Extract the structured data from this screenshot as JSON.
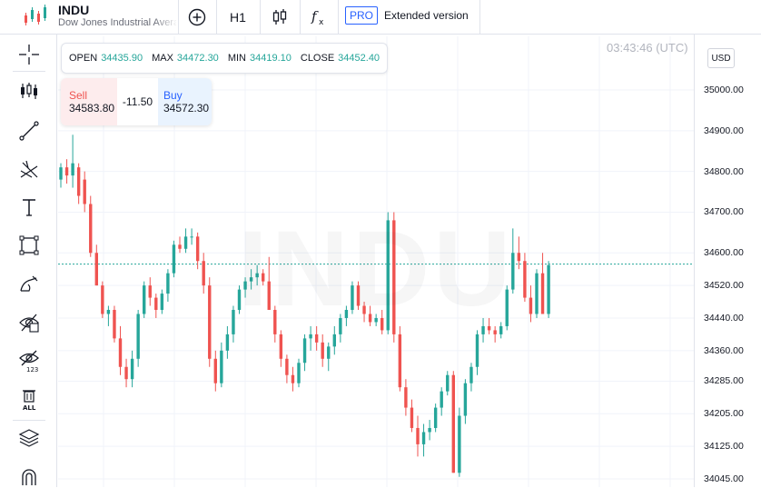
{
  "header": {
    "symbol": "INDU",
    "name": "Dow Jones Industrial Average",
    "timeframe": "H1",
    "pro_label": "PRO",
    "extended_label": "Extended version"
  },
  "ohlc": {
    "open_label": "OPEN",
    "open": "34435.90",
    "max_label": "MAX",
    "max": "34472.30",
    "min_label": "MIN",
    "min": "34419.10",
    "close_label": "CLOSE",
    "close": "34452.40"
  },
  "trade": {
    "sell_label": "Sell",
    "sell_price": "34583.80",
    "spread": "-11.50",
    "buy_label": "Buy",
    "buy_price": "34572.30"
  },
  "time": "03:43:46 (UTC)",
  "currency": "USD",
  "watermark": "INDU",
  "colors": {
    "up": "#26a69a",
    "down": "#ef5350",
    "accent": "#2962ff",
    "grid": "#f0f3fa"
  },
  "left_tools": [
    "crosshair-icon",
    "candles-icon",
    "trend-line-icon",
    "fib-icon",
    "text-icon",
    "rectangle-icon",
    "brush-icon",
    "hide-drawings-icon",
    "hide-indicators-icon",
    "delete-all-icon",
    "layers-icon",
    "magnet-icon"
  ],
  "delete_all_label": "ALL",
  "hide_indicators_label": "123",
  "chart_data": {
    "type": "candlestick",
    "y_ticks": [
      "35000.00",
      "34900.00",
      "34800.00",
      "34700.00",
      "34600.00",
      "34520.00",
      "34440.00",
      "34360.00",
      "34285.00",
      "34205.00",
      "34125.00",
      "34045.00"
    ],
    "last_price": 34572.3,
    "candles": [
      [
        34780,
        34820,
        34760,
        34810
      ],
      [
        34810,
        34830,
        34770,
        34790
      ],
      [
        34790,
        34890,
        34760,
        34820
      ],
      [
        34810,
        34820,
        34720,
        34740
      ],
      [
        34780,
        34800,
        34700,
        34720
      ],
      [
        34720,
        34740,
        34590,
        34600
      ],
      [
        34600,
        34620,
        34520,
        34520
      ],
      [
        34520,
        34530,
        34440,
        34450
      ],
      [
        34450,
        34470,
        34420,
        34460
      ],
      [
        34460,
        34470,
        34380,
        34390
      ],
      [
        34390,
        34420,
        34300,
        34320
      ],
      [
        34320,
        34340,
        34270,
        34290
      ],
      [
        34290,
        34360,
        34270,
        34340
      ],
      [
        34340,
        34460,
        34320,
        34450
      ],
      [
        34450,
        34530,
        34440,
        34520
      ],
      [
        34520,
        34540,
        34470,
        34490
      ],
      [
        34490,
        34500,
        34440,
        34460
      ],
      [
        34460,
        34510,
        34450,
        34500
      ],
      [
        34500,
        34560,
        34480,
        34550
      ],
      [
        34550,
        34630,
        34540,
        34620
      ],
      [
        34620,
        34640,
        34600,
        34610
      ],
      [
        34610,
        34660,
        34600,
        34640
      ],
      [
        34640,
        34660,
        34620,
        34640
      ],
      [
        34640,
        34650,
        34560,
        34580
      ],
      [
        34580,
        34600,
        34500,
        34520
      ],
      [
        34520,
        34540,
        34320,
        34340
      ],
      [
        34340,
        34360,
        34260,
        34280
      ],
      [
        34280,
        34380,
        34270,
        34360
      ],
      [
        34360,
        34420,
        34340,
        34400
      ],
      [
        34400,
        34470,
        34380,
        34460
      ],
      [
        34460,
        34520,
        34450,
        34510
      ],
      [
        34510,
        34540,
        34490,
        34530
      ],
      [
        34530,
        34560,
        34510,
        34540
      ],
      [
        34540,
        34570,
        34520,
        34550
      ],
      [
        34550,
        34560,
        34520,
        34530
      ],
      [
        34530,
        34590,
        34500,
        34460
      ],
      [
        34460,
        34470,
        34380,
        34400
      ],
      [
        34400,
        34410,
        34320,
        34340
      ],
      [
        34340,
        34350,
        34280,
        34300
      ],
      [
        34300,
        34320,
        34260,
        34280
      ],
      [
        34280,
        34340,
        34270,
        34330
      ],
      [
        34330,
        34400,
        34310,
        34390
      ],
      [
        34390,
        34420,
        34360,
        34400
      ],
      [
        34400,
        34420,
        34360,
        34380
      ],
      [
        34380,
        34400,
        34320,
        34340
      ],
      [
        34340,
        34380,
        34310,
        34370
      ],
      [
        34370,
        34420,
        34350,
        34400
      ],
      [
        34400,
        34450,
        34380,
        34440
      ],
      [
        34440,
        34470,
        34420,
        34460
      ],
      [
        34460,
        34530,
        34450,
        34520
      ],
      [
        34520,
        34530,
        34460,
        34470
      ],
      [
        34470,
        34480,
        34430,
        34450
      ],
      [
        34450,
        34470,
        34420,
        34430
      ],
      [
        34430,
        34450,
        34420,
        34440
      ],
      [
        34440,
        34460,
        34400,
        34410
      ],
      [
        34410,
        34700,
        34400,
        34680
      ],
      [
        34680,
        34700,
        34380,
        34400
      ],
      [
        34400,
        34420,
        34260,
        34270
      ],
      [
        34270,
        34290,
        34200,
        34220
      ],
      [
        34220,
        34240,
        34160,
        34170
      ],
      [
        34170,
        34200,
        34100,
        34130
      ],
      [
        34130,
        34180,
        34100,
        34160
      ],
      [
        34160,
        34190,
        34140,
        34170
      ],
      [
        34170,
        34230,
        34160,
        34220
      ],
      [
        34220,
        34270,
        34200,
        34260
      ],
      [
        34260,
        34310,
        34250,
        34300
      ],
      [
        34300,
        34310,
        34060,
        34060
      ],
      [
        34060,
        34220,
        34050,
        34200
      ],
      [
        34200,
        34290,
        34180,
        34280
      ],
      [
        34280,
        34330,
        34260,
        34320
      ],
      [
        34320,
        34410,
        34300,
        34400
      ],
      [
        34400,
        34440,
        34380,
        34420
      ],
      [
        34420,
        34440,
        34400,
        34410
      ],
      [
        34410,
        34420,
        34380,
        34400
      ],
      [
        34400,
        34430,
        34390,
        34420
      ],
      [
        34420,
        34520,
        34410,
        34510
      ],
      [
        34510,
        34660,
        34500,
        34600
      ],
      [
        34600,
        34640,
        34560,
        34580
      ],
      [
        34580,
        34600,
        34480,
        34490
      ],
      [
        34490,
        34520,
        34430,
        34450
      ],
      [
        34450,
        34560,
        34440,
        34550
      ],
      [
        34550,
        34600,
        34450,
        34450
      ],
      [
        34450,
        34580,
        34440,
        34570
      ]
    ]
  }
}
